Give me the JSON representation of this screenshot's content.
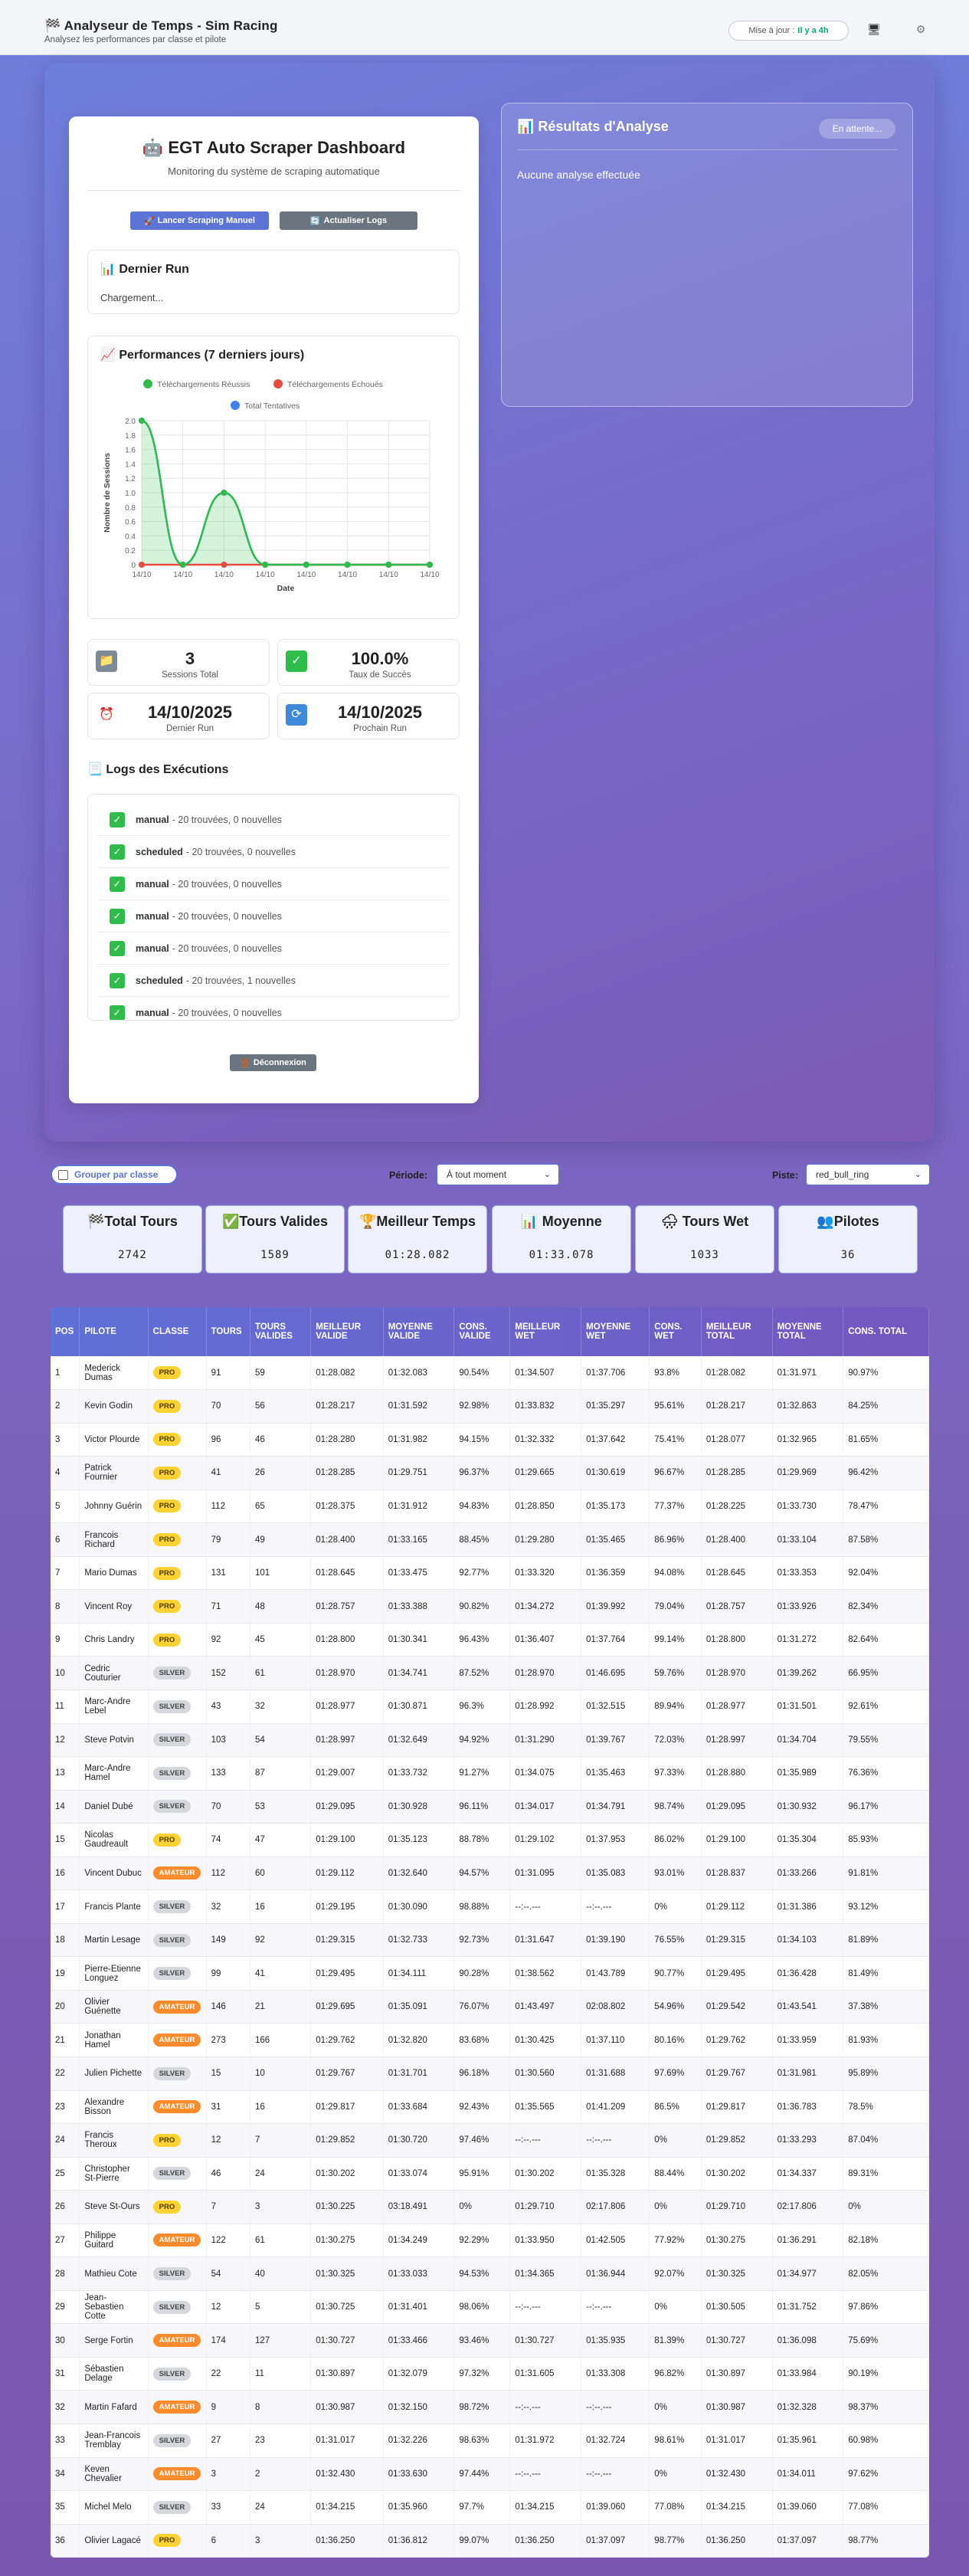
{
  "header": {
    "title": "🏁 Analyseur de Temps - Sim Racing",
    "subtitle": "Analysez les performances par classe et pilote",
    "update_label": "Mise à jour :",
    "update_value": "Il y a 4h"
  },
  "dashboard": {
    "title": "🤖 EGT Auto Scraper Dashboard",
    "subtitle": "Monitoring du système de scraping automatique",
    "scrape_button": "Lancer Scraping Manuel",
    "logs_button": "Actualiser Logs",
    "last_run_title": "📊 Dernier Run",
    "last_run_status": "Chargement...",
    "perf_title": "📈 Performances (7 derniers jours)",
    "stats": [
      {
        "value": "3",
        "label": "Sessions Total",
        "icon": "folder-icon"
      },
      {
        "value": "100.0%",
        "label": "Taux de Succès",
        "icon": "check-icon"
      },
      {
        "value": "14/10/2025",
        "label": "Dernier Run",
        "icon": "alarm-icon"
      },
      {
        "value": "14/10/2025",
        "label": "Prochain Run",
        "icon": "refresh-icon"
      }
    ],
    "logs_title": "📃 Logs des Exécutions",
    "logs": [
      {
        "mode": "manual",
        "desc": "- 20 trouvées, 0 nouvelles"
      },
      {
        "mode": "scheduled",
        "desc": "- 20 trouvées, 0 nouvelles"
      },
      {
        "mode": "manual",
        "desc": "- 20 trouvées, 0 nouvelles"
      },
      {
        "mode": "manual",
        "desc": "- 20 trouvées, 0 nouvelles"
      },
      {
        "mode": "manual",
        "desc": "- 20 trouvées, 0 nouvelles"
      },
      {
        "mode": "scheduled",
        "desc": "- 20 trouvées, 1 nouvelles"
      },
      {
        "mode": "manual",
        "desc": "- 20 trouvées, 0 nouvelles"
      }
    ],
    "logout_button": "Déconnexion"
  },
  "chart_data": {
    "type": "line",
    "categories": [
      "14/10",
      "14/10",
      "14/10",
      "14/10",
      "14/10",
      "14/10",
      "14/10",
      "14/10"
    ],
    "series": [
      {
        "name": "Téléchargements Réussis",
        "color": "#2ebd4a",
        "values": [
          2,
          0,
          1,
          0,
          0,
          0,
          0,
          0
        ]
      },
      {
        "name": "Téléchargements Échoués",
        "color": "#e74c3c",
        "values": [
          0,
          0,
          0,
          0,
          0,
          0,
          0,
          0
        ]
      },
      {
        "name": "Total Tentatives",
        "color": "#3b82f6",
        "values": [
          2,
          0,
          1,
          0,
          0,
          0,
          0,
          0
        ]
      }
    ],
    "yticks": [
      "0",
      "0.2",
      "0.4",
      "0.6",
      "0.8",
      "1.0",
      "1.2",
      "1.4",
      "1.6",
      "1.8",
      "2.0"
    ],
    "ylim": [
      0,
      2
    ],
    "xlabel": "Date",
    "ylabel": "Nombre de Sessions",
    "grid": true,
    "legend": "top"
  },
  "results": {
    "title": "📊 Résultats d'Analyse",
    "status": "En attente...",
    "empty": "Aucune analyse effectuée"
  },
  "filters": {
    "group_label": "Grouper par classe",
    "period_label": "Période:",
    "period_value": "À tout moment",
    "track_label": "Piste:",
    "track_value": "red_bull_ring"
  },
  "kpis": [
    {
      "title": "🏁Total Tours",
      "value": "2742"
    },
    {
      "title": "✅Tours Valides",
      "value": "1589"
    },
    {
      "title": "🏆Meilleur Temps",
      "value": "01:28.082"
    },
    {
      "title": "📊 Moyenne",
      "value": "01:33.078"
    },
    {
      "title": "🌧 Tours Wet",
      "value": "1033"
    },
    {
      "title": "👥Pilotes",
      "value": "36"
    }
  ],
  "table": {
    "columns": [
      "POS",
      "PILOTE",
      "CLASSE",
      "TOURS",
      "TOURS VALIDES",
      "MEILLEUR VALIDE",
      "MOYENNE VALIDE",
      "CONS. VALIDE",
      "MEILLEUR WET",
      "MOYENNE WET",
      "CONS. WET",
      "MEILLEUR TOTAL",
      "MOYENNE TOTAL",
      "CONS. TOTAL"
    ],
    "rows": [
      [
        "1",
        "Mederick Dumas",
        "PRO",
        "91",
        "59",
        "01:28.082",
        "01:32.083",
        "90.54%",
        "01:34.507",
        "01:37.706",
        "93.8%",
        "01:28.082",
        "01:31.971",
        "90.97%"
      ],
      [
        "2",
        "Kevin Godin",
        "PRO",
        "70",
        "56",
        "01:28.217",
        "01:31.592",
        "92.98%",
        "01:33.832",
        "01:35.297",
        "95.61%",
        "01:28.217",
        "01:32.863",
        "84.25%"
      ],
      [
        "3",
        "Victor Plourde",
        "PRO",
        "96",
        "46",
        "01:28.280",
        "01:31.982",
        "94.15%",
        "01:32.332",
        "01:37.642",
        "75.41%",
        "01:28.077",
        "01:32.965",
        "81.65%"
      ],
      [
        "4",
        "Patrick Fournier",
        "PRO",
        "41",
        "26",
        "01:28.285",
        "01:29.751",
        "96.37%",
        "01:29.665",
        "01:30.619",
        "96.67%",
        "01:28.285",
        "01:29.969",
        "96.42%"
      ],
      [
        "5",
        "Johnny Guérin",
        "PRO",
        "112",
        "65",
        "01:28.375",
        "01:31.912",
        "94.83%",
        "01:28.850",
        "01:35.173",
        "77.37%",
        "01:28.225",
        "01:33.730",
        "78.47%"
      ],
      [
        "6",
        "Francois Richard",
        "PRO",
        "79",
        "49",
        "01:28.400",
        "01:33.165",
        "88.45%",
        "01:29.280",
        "01:35.465",
        "86.96%",
        "01:28.400",
        "01:33.104",
        "87.58%"
      ],
      [
        "7",
        "Mario Dumas",
        "PRO",
        "131",
        "101",
        "01:28.645",
        "01:33.475",
        "92.77%",
        "01:33.320",
        "01:36.359",
        "94.08%",
        "01:28.645",
        "01:33.353",
        "92.04%"
      ],
      [
        "8",
        "Vincent Roy",
        "PRO",
        "71",
        "48",
        "01:28.757",
        "01:33.388",
        "90.82%",
        "01:34.272",
        "01:39.992",
        "79.04%",
        "01:28.757",
        "01:33.926",
        "82.34%"
      ],
      [
        "9",
        "Chris Landry",
        "PRO",
        "92",
        "45",
        "01:28.800",
        "01:30.341",
        "96.43%",
        "01:36.407",
        "01:37.764",
        "99.14%",
        "01:28.800",
        "01:31.272",
        "82.64%"
      ],
      [
        "10",
        "Cedric Couturier",
        "SILVER",
        "152",
        "61",
        "01:28.970",
        "01:34.741",
        "87.52%",
        "01:28.970",
        "01:46.695",
        "59.76%",
        "01:28.970",
        "01:39.262",
        "66.95%"
      ],
      [
        "11",
        "Marc-Andre Lebel",
        "SILVER",
        "43",
        "32",
        "01:28.977",
        "01:30.871",
        "96.3%",
        "01:28.992",
        "01:32.515",
        "89.94%",
        "01:28.977",
        "01:31.501",
        "92.61%"
      ],
      [
        "12",
        "Steve Potvin",
        "SILVER",
        "103",
        "54",
        "01:28.997",
        "01:32.649",
        "94.92%",
        "01:31.290",
        "01:39.767",
        "72.03%",
        "01:28.997",
        "01:34.704",
        "79.55%"
      ],
      [
        "13",
        "Marc-Andre Hamel",
        "SILVER",
        "133",
        "87",
        "01:29.007",
        "01:33.732",
        "91.27%",
        "01:34.075",
        "01:35.463",
        "97.33%",
        "01:28.880",
        "01:35.989",
        "76.36%"
      ],
      [
        "14",
        "Daniel Dubé",
        "SILVER",
        "70",
        "53",
        "01:29.095",
        "01:30.928",
        "96.11%",
        "01:34.017",
        "01:34.791",
        "98.74%",
        "01:29.095",
        "01:30.932",
        "96.17%"
      ],
      [
        "15",
        "Nicolas Gaudreault",
        "PRO",
        "74",
        "47",
        "01:29.100",
        "01:35.123",
        "88.78%",
        "01:29.102",
        "01:37.953",
        "86.02%",
        "01:29.100",
        "01:35.304",
        "85.93%"
      ],
      [
        "16",
        "Vincent Dubuc",
        "AMATEUR",
        "112",
        "60",
        "01:29.112",
        "01:32.640",
        "94.57%",
        "01:31.095",
        "01:35.083",
        "93.01%",
        "01:28.837",
        "01:33.266",
        "91.81%"
      ],
      [
        "17",
        "Francis Plante",
        "SILVER",
        "32",
        "16",
        "01:29.195",
        "01:30.090",
        "98.88%",
        "--:--.---",
        "--:--.---",
        "0%",
        "01:29.112",
        "01:31.386",
        "93.12%"
      ],
      [
        "18",
        "Martin Lesage",
        "SILVER",
        "149",
        "92",
        "01:29.315",
        "01:32.733",
        "92.73%",
        "01:31.647",
        "01:39.190",
        "76.55%",
        "01:29.315",
        "01:34.103",
        "81.89%"
      ],
      [
        "19",
        "Pierre-Etienne Longuez",
        "SILVER",
        "99",
        "41",
        "01:29.495",
        "01:34.111",
        "90.28%",
        "01:38.562",
        "01:43.789",
        "90.77%",
        "01:29.495",
        "01:36.428",
        "81.49%"
      ],
      [
        "20",
        "Olivier Guénette",
        "AMATEUR",
        "146",
        "21",
        "01:29.695",
        "01:35.091",
        "76.07%",
        "01:43.497",
        "02:08.802",
        "54.96%",
        "01:29.542",
        "01:43.541",
        "37.38%"
      ],
      [
        "21",
        "Jonathan Hamel",
        "AMATEUR",
        "273",
        "166",
        "01:29.762",
        "01:32.820",
        "83.68%",
        "01:30.425",
        "01:37.110",
        "80.16%",
        "01:29.762",
        "01:33.959",
        "81.93%"
      ],
      [
        "22",
        "Julien Pichette",
        "SILVER",
        "15",
        "10",
        "01:29.767",
        "01:31.701",
        "96.18%",
        "01:30.560",
        "01:31.688",
        "97.69%",
        "01:29.767",
        "01:31.981",
        "95.89%"
      ],
      [
        "23",
        "Alexandre Bisson",
        "AMATEUR",
        "31",
        "16",
        "01:29.817",
        "01:33.684",
        "92.43%",
        "01:35.565",
        "01:41.209",
        "86.5%",
        "01:29.817",
        "01:36.783",
        "78.5%"
      ],
      [
        "24",
        "Francis Theroux",
        "PRO",
        "12",
        "7",
        "01:29.852",
        "01:30.720",
        "97.46%",
        "--:--.---",
        "--:--.---",
        "0%",
        "01:29.852",
        "01:33.293",
        "87.04%"
      ],
      [
        "25",
        "Christopher St-Pierre",
        "SILVER",
        "46",
        "24",
        "01:30.202",
        "01:33.074",
        "95.91%",
        "01:30.202",
        "01:35.328",
        "88.44%",
        "01:30.202",
        "01:34.337",
        "89.31%"
      ],
      [
        "26",
        "Steve St-Ours",
        "PRO",
        "7",
        "3",
        "01:30.225",
        "03:18.491",
        "0%",
        "01:29.710",
        "02:17.806",
        "0%",
        "01:29.710",
        "02:17.806",
        "0%"
      ],
      [
        "27",
        "Philippe Guitard",
        "AMATEUR",
        "122",
        "61",
        "01:30.275",
        "01:34.249",
        "92.29%",
        "01:33.950",
        "01:42.505",
        "77.92%",
        "01:30.275",
        "01:36.291",
        "82.18%"
      ],
      [
        "28",
        "Mathieu Cote",
        "SILVER",
        "54",
        "40",
        "01:30.325",
        "01:33.033",
        "94.53%",
        "01:34.365",
        "01:36.944",
        "92.07%",
        "01:30.325",
        "01:34.977",
        "82.05%"
      ],
      [
        "29",
        "Jean-Sebastien Cotte",
        "SILVER",
        "12",
        "5",
        "01:30.725",
        "01:31.401",
        "98.06%",
        "--:--.---",
        "--:--.---",
        "0%",
        "01:30.505",
        "01:31.752",
        "97.86%"
      ],
      [
        "30",
        "Serge Fortin",
        "AMATEUR",
        "174",
        "127",
        "01:30.727",
        "01:33.466",
        "93.46%",
        "01:30.727",
        "01:35.935",
        "81.39%",
        "01:30.727",
        "01:36.098",
        "75.69%"
      ],
      [
        "31",
        "Sébastien Delage",
        "SILVER",
        "22",
        "11",
        "01:30.897",
        "01:32.079",
        "97.32%",
        "01:31.605",
        "01:33.308",
        "96.82%",
        "01:30.897",
        "01:33.984",
        "90.19%"
      ],
      [
        "32",
        "Martin Fafard",
        "AMATEUR",
        "9",
        "8",
        "01:30.987",
        "01:32.150",
        "98.72%",
        "--:--.---",
        "--:--.---",
        "0%",
        "01:30.987",
        "01:32.328",
        "98.37%"
      ],
      [
        "33",
        "Jean-Francois Tremblay",
        "SILVER",
        "27",
        "23",
        "01:31.017",
        "01:32.226",
        "98.63%",
        "01:31.972",
        "01:32.724",
        "98.61%",
        "01:31.017",
        "01:35.961",
        "60.98%"
      ],
      [
        "34",
        "Keven Chevalier",
        "AMATEUR",
        "3",
        "2",
        "01:32.430",
        "01:33.630",
        "97.44%",
        "--:--.---",
        "--:--.---",
        "0%",
        "01:32.430",
        "01:34.011",
        "97.62%"
      ],
      [
        "35",
        "Michel Melo",
        "SILVER",
        "33",
        "24",
        "01:34.215",
        "01:35.960",
        "97.7%",
        "01:34.215",
        "01:39.060",
        "77.08%",
        "01:34.215",
        "01:39.060",
        "77.08%"
      ],
      [
        "36",
        "Olivier Lagacé",
        "PRO",
        "6",
        "3",
        "01:36.250",
        "01:36.812",
        "99.07%",
        "01:36.250",
        "01:37.097",
        "98.77%",
        "01:36.250",
        "01:37.097",
        "98.77%"
      ]
    ]
  }
}
